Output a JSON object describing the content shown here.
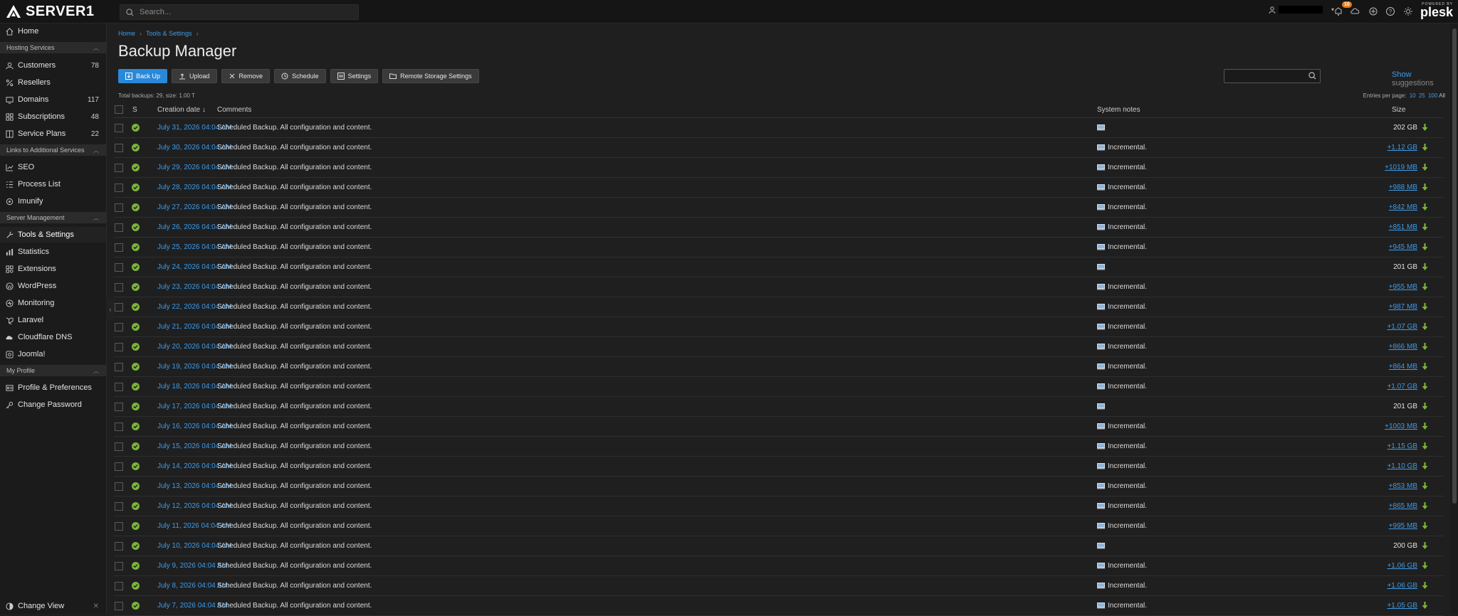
{
  "app": {
    "brand": "SERVER1",
    "search_placeholder": "Search...",
    "notifications_count": "10",
    "powered_by": "POWERED BY",
    "plesk": "plesk"
  },
  "colors": {
    "accent": "#2a88d8",
    "link": "#3d9be9",
    "success": "#7bb33a",
    "badge": "#e07a20"
  },
  "sidebar": {
    "home": "Home",
    "groups": {
      "hosting": "Hosting Services",
      "links": "Links to Additional Services",
      "server": "Server Management",
      "profile": "My Profile"
    },
    "items": [
      {
        "label": "Customers",
        "count": "78",
        "icon": "user-icon"
      },
      {
        "label": "Resellers",
        "count": "",
        "icon": "percent-icon"
      },
      {
        "label": "Domains",
        "count": "117",
        "icon": "monitor-icon"
      },
      {
        "label": "Subscriptions",
        "count": "48",
        "icon": "grid-icon"
      },
      {
        "label": "Service Plans",
        "count": "22",
        "icon": "book-icon"
      },
      {
        "label": "SEO",
        "count": "",
        "icon": "chart-icon"
      },
      {
        "label": "Process List",
        "count": "",
        "icon": "list-icon"
      },
      {
        "label": "Imunify",
        "count": "",
        "icon": "shield-icon"
      },
      {
        "label": "Tools & Settings",
        "count": "",
        "icon": "tools-icon"
      },
      {
        "label": "Statistics",
        "count": "",
        "icon": "stats-icon"
      },
      {
        "label": "Extensions",
        "count": "",
        "icon": "extensions-icon"
      },
      {
        "label": "WordPress",
        "count": "",
        "icon": "wordpress-icon"
      },
      {
        "label": "Monitoring",
        "count": "",
        "icon": "monitoring-icon"
      },
      {
        "label": "Laravel",
        "count": "",
        "icon": "laravel-icon"
      },
      {
        "label": "Cloudflare DNS",
        "count": "",
        "icon": "cloud-icon"
      },
      {
        "label": "Joomla!",
        "count": "",
        "icon": "joomla-icon"
      },
      {
        "label": "Profile & Preferences",
        "count": "",
        "icon": "profile-icon"
      },
      {
        "label": "Change Password",
        "count": "",
        "icon": "key-icon"
      }
    ],
    "change_view": "Change View"
  },
  "breadcrumb": [
    "Home",
    "Tools & Settings"
  ],
  "page": {
    "title": "Backup Manager",
    "toolbar": {
      "backup": "Back Up",
      "upload": "Upload",
      "remove": "Remove",
      "schedule": "Schedule",
      "settings": "Settings",
      "remote": "Remote Storage Settings"
    },
    "suggestions_show": "Show",
    "suggestions_label": "suggestions",
    "totals": "Total backups: 29, size: 1.00 T",
    "per_page_label": "Entries per page:",
    "per_page_options": [
      "10",
      "25",
      "100"
    ],
    "per_page_all": "All"
  },
  "table": {
    "headers": {
      "status": "S",
      "date": "Creation date ↓",
      "comments": "Comments",
      "notes": "System notes",
      "size": "Size"
    },
    "rows": [
      {
        "date": "July 31, 2026 04:04 AM",
        "comment": "Scheduled Backup. All configuration and content.",
        "note": "",
        "size": "202 GB",
        "inc": false
      },
      {
        "date": "July 30, 2026 04:04 AM",
        "comment": "Scheduled Backup. All configuration and content.",
        "note": "Incremental.",
        "size": "+1.12 GB",
        "inc": true
      },
      {
        "date": "July 29, 2026 04:04 AM",
        "comment": "Scheduled Backup. All configuration and content.",
        "note": "Incremental.",
        "size": "+1019 MB",
        "inc": true
      },
      {
        "date": "July 28, 2026 04:04 AM",
        "comment": "Scheduled Backup. All configuration and content.",
        "note": "Incremental.",
        "size": "+988 MB",
        "inc": true
      },
      {
        "date": "July 27, 2026 04:04 AM",
        "comment": "Scheduled Backup. All configuration and content.",
        "note": "Incremental.",
        "size": "+842 MB",
        "inc": true
      },
      {
        "date": "July 26, 2026 04:04 AM",
        "comment": "Scheduled Backup. All configuration and content.",
        "note": "Incremental.",
        "size": "+851 MB",
        "inc": true
      },
      {
        "date": "July 25, 2026 04:04 AM",
        "comment": "Scheduled Backup. All configuration and content.",
        "note": "Incremental.",
        "size": "+945 MB",
        "inc": true
      },
      {
        "date": "July 24, 2026 04:04 AM",
        "comment": "Scheduled Backup. All configuration and content.",
        "note": "",
        "size": "201 GB",
        "inc": false
      },
      {
        "date": "July 23, 2026 04:04 AM",
        "comment": "Scheduled Backup. All configuration and content.",
        "note": "Incremental.",
        "size": "+955 MB",
        "inc": true
      },
      {
        "date": "July 22, 2026 04:04 AM",
        "comment": "Scheduled Backup. All configuration and content.",
        "note": "Incremental.",
        "size": "+987 MB",
        "inc": true
      },
      {
        "date": "July 21, 2026 04:04 AM",
        "comment": "Scheduled Backup. All configuration and content.",
        "note": "Incremental.",
        "size": "+1.07 GB",
        "inc": true
      },
      {
        "date": "July 20, 2026 04:04 AM",
        "comment": "Scheduled Backup. All configuration and content.",
        "note": "Incremental.",
        "size": "+866 MB",
        "inc": true
      },
      {
        "date": "July 19, 2026 04:04 AM",
        "comment": "Scheduled Backup. All configuration and content.",
        "note": "Incremental.",
        "size": "+864 MB",
        "inc": true
      },
      {
        "date": "July 18, 2026 04:04 AM",
        "comment": "Scheduled Backup. All configuration and content.",
        "note": "Incremental.",
        "size": "+1.07 GB",
        "inc": true
      },
      {
        "date": "July 17, 2026 04:04 AM",
        "comment": "Scheduled Backup. All configuration and content.",
        "note": "",
        "size": "201 GB",
        "inc": false
      },
      {
        "date": "July 16, 2026 04:04 AM",
        "comment": "Scheduled Backup. All configuration and content.",
        "note": "Incremental.",
        "size": "+1003 MB",
        "inc": true
      },
      {
        "date": "July 15, 2026 04:04 AM",
        "comment": "Scheduled Backup. All configuration and content.",
        "note": "Incremental.",
        "size": "+1.15 GB",
        "inc": true
      },
      {
        "date": "July 14, 2026 04:04 AM",
        "comment": "Scheduled Backup. All configuration and content.",
        "note": "Incremental.",
        "size": "+1.10 GB",
        "inc": true
      },
      {
        "date": "July 13, 2026 04:04 AM",
        "comment": "Scheduled Backup. All configuration and content.",
        "note": "Incremental.",
        "size": "+853 MB",
        "inc": true
      },
      {
        "date": "July 12, 2026 04:04 AM",
        "comment": "Scheduled Backup. All configuration and content.",
        "note": "Incremental.",
        "size": "+865 MB",
        "inc": true
      },
      {
        "date": "July 11, 2026 04:04 AM",
        "comment": "Scheduled Backup. All configuration and content.",
        "note": "Incremental.",
        "size": "+995 MB",
        "inc": true
      },
      {
        "date": "July 10, 2026 04:04 AM",
        "comment": "Scheduled Backup. All configuration and content.",
        "note": "",
        "size": "200 GB",
        "inc": false
      },
      {
        "date": "July 9, 2026 04:04 AM",
        "comment": "Scheduled Backup. All configuration and content.",
        "note": "Incremental.",
        "size": "+1.06 GB",
        "inc": true
      },
      {
        "date": "July 8, 2026 04:04 AM",
        "comment": "Scheduled Backup. All configuration and content.",
        "note": "Incremental.",
        "size": "+1.06 GB",
        "inc": true
      },
      {
        "date": "July 7, 2026 04:04 AM",
        "comment": "Scheduled Backup. All configuration and content.",
        "note": "Incremental.",
        "size": "+1.05 GB",
        "inc": true
      }
    ]
  }
}
